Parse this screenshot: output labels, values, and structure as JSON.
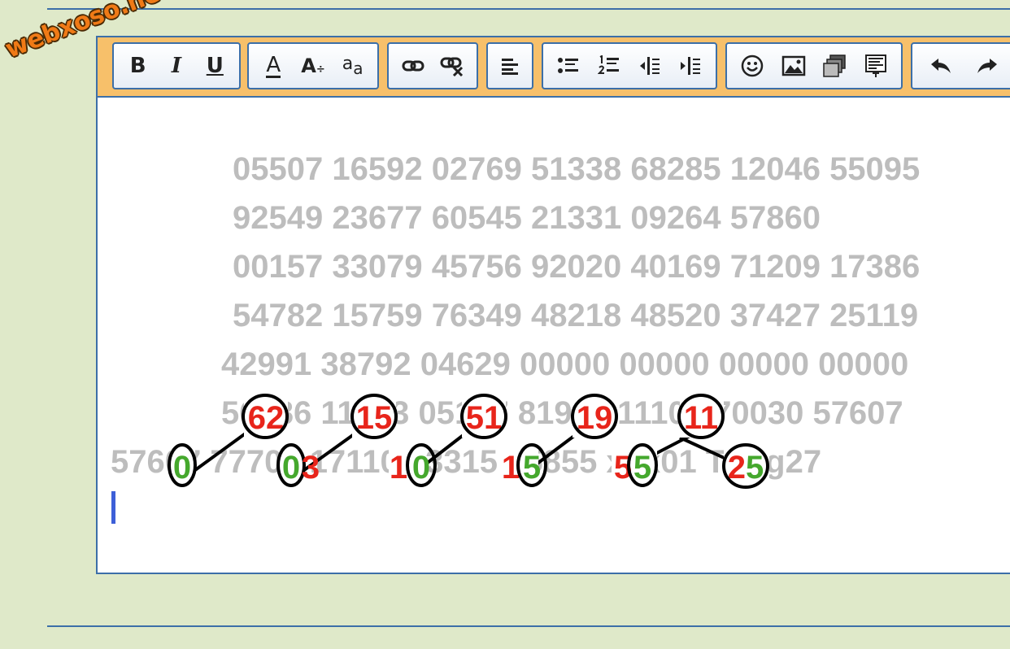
{
  "watermark": "webxoso.net",
  "toolbar": {
    "bold_label": "B",
    "italic_label": "I",
    "underline_label": "U",
    "font_color_label": "A",
    "font_size_label": "A",
    "font_size_sub": "÷",
    "superscript_label": "a",
    "superscript_sub": "a",
    "icons": [
      "bold-icon",
      "italic-icon",
      "underline-icon",
      "font-color-icon",
      "font-size-icon",
      "text-style-icon",
      "link-icon",
      "unlink-icon",
      "align-left-icon",
      "bullet-list-icon",
      "numbered-list-icon",
      "outdent-icon",
      "indent-icon",
      "smiley-icon",
      "image-icon",
      "media-icon",
      "code-icon",
      "undo-icon",
      "redo-icon"
    ]
  },
  "content": {
    "lines": [
      "05507 16592 02769 51338 68285 12046 55095",
      "92549 23677 60545 21331 09264 57860",
      "00157 33079 45756 92020 40169 71209 17386",
      "54782 15759 76349 48218 48520 37427 25119",
      "42991 38792 04629 00000 00000 00000 00000",
      "56286 11503 05177 81910 11103 70030 57607",
      "57607 77703 17110 93315 35855 xxx01 Tổng27"
    ],
    "circled_top": [
      "62",
      "15",
      "51",
      "19",
      "11"
    ],
    "circled_bottom": [
      "0",
      "0",
      "0",
      "5",
      "5",
      "25"
    ],
    "red_bottom_digits": [
      "3",
      "1",
      "1",
      "5"
    ]
  },
  "colors": {
    "background": "#dfe9c9",
    "toolbar": "#f7c06a",
    "border": "#3c6fa8",
    "digits_gray": "#bdbdbd",
    "highlight_red": "#e8251b",
    "highlight_green": "#45a82d",
    "watermark": "#f07a16",
    "caret": "#3d5fd8"
  }
}
